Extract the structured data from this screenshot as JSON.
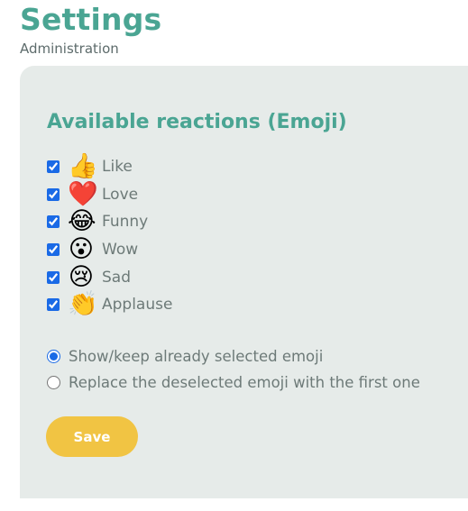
{
  "header": {
    "title": "Settings",
    "subtitle": "Administration"
  },
  "reactions_section": {
    "title": "Available reactions (Emoji)",
    "items": [
      {
        "label": "Like",
        "emoji": "👍",
        "icon": "thumbs-up-icon",
        "checked": true
      },
      {
        "label": "Love",
        "emoji": "❤️",
        "icon": "heart-icon",
        "checked": true
      },
      {
        "label": "Funny",
        "emoji": "😂",
        "icon": "laughing-face-icon",
        "checked": true
      },
      {
        "label": "Wow",
        "emoji": "😮",
        "icon": "surprised-face-icon",
        "checked": true
      },
      {
        "label": "Sad",
        "emoji": "😢",
        "icon": "crying-face-icon",
        "checked": true
      },
      {
        "label": "Applause",
        "emoji": "👏",
        "icon": "clapping-hands-icon",
        "checked": true
      }
    ]
  },
  "options": [
    {
      "label": "Show/keep already selected emoji",
      "selected": true
    },
    {
      "label": "Replace the deselected emoji with the first one",
      "selected": false
    }
  ],
  "save_button": {
    "label": "Save"
  },
  "colors": {
    "title_accent": "#4aa593",
    "panel_background": "#e6ebe9",
    "button_background": "#f1c443",
    "control_blue": "#1a6ae6",
    "label_text": "#6d7a78"
  }
}
